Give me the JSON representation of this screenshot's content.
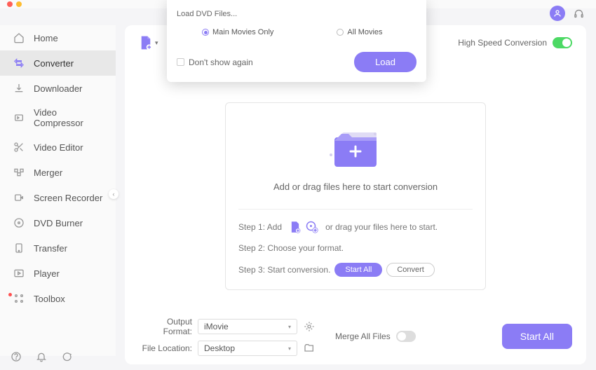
{
  "sidebar": {
    "items": [
      {
        "icon": "home",
        "label": "Home"
      },
      {
        "icon": "converter",
        "label": "Converter"
      },
      {
        "icon": "download",
        "label": "Downloader"
      },
      {
        "icon": "compress",
        "label": "Video Compressor"
      },
      {
        "icon": "editor",
        "label": "Video Editor"
      },
      {
        "icon": "merger",
        "label": "Merger"
      },
      {
        "icon": "recorder",
        "label": "Screen Recorder"
      },
      {
        "icon": "dvd",
        "label": "DVD Burner"
      },
      {
        "icon": "transfer",
        "label": "Transfer"
      },
      {
        "icon": "player",
        "label": "Player"
      },
      {
        "icon": "toolbox",
        "label": "Toolbox"
      }
    ]
  },
  "header": {
    "high_speed_label": "High Speed Conversion"
  },
  "dropzone": {
    "text": "Add or drag files here to start conversion",
    "step1_prefix": "Step 1: Add",
    "step1_suffix": "or drag your files here to start.",
    "step2": "Step 2: Choose your format.",
    "step3": "Step 3: Start conversion.",
    "start_all_btn": "Start  All",
    "convert_btn": "Convert"
  },
  "bottom": {
    "output_format_label": "Output Format:",
    "output_format_value": "iMovie",
    "file_location_label": "File Location:",
    "file_location_value": "Desktop",
    "merge_label": "Merge All Files",
    "start_all": "Start All"
  },
  "modal": {
    "title": "Load DVD Files...",
    "opt1": "Main Movies Only",
    "opt2": "All Movies",
    "dont_show": "Don't show again",
    "load_btn": "Load"
  },
  "colors": {
    "accent": "#8b7cf5",
    "toggle_on": "#4cd964"
  }
}
